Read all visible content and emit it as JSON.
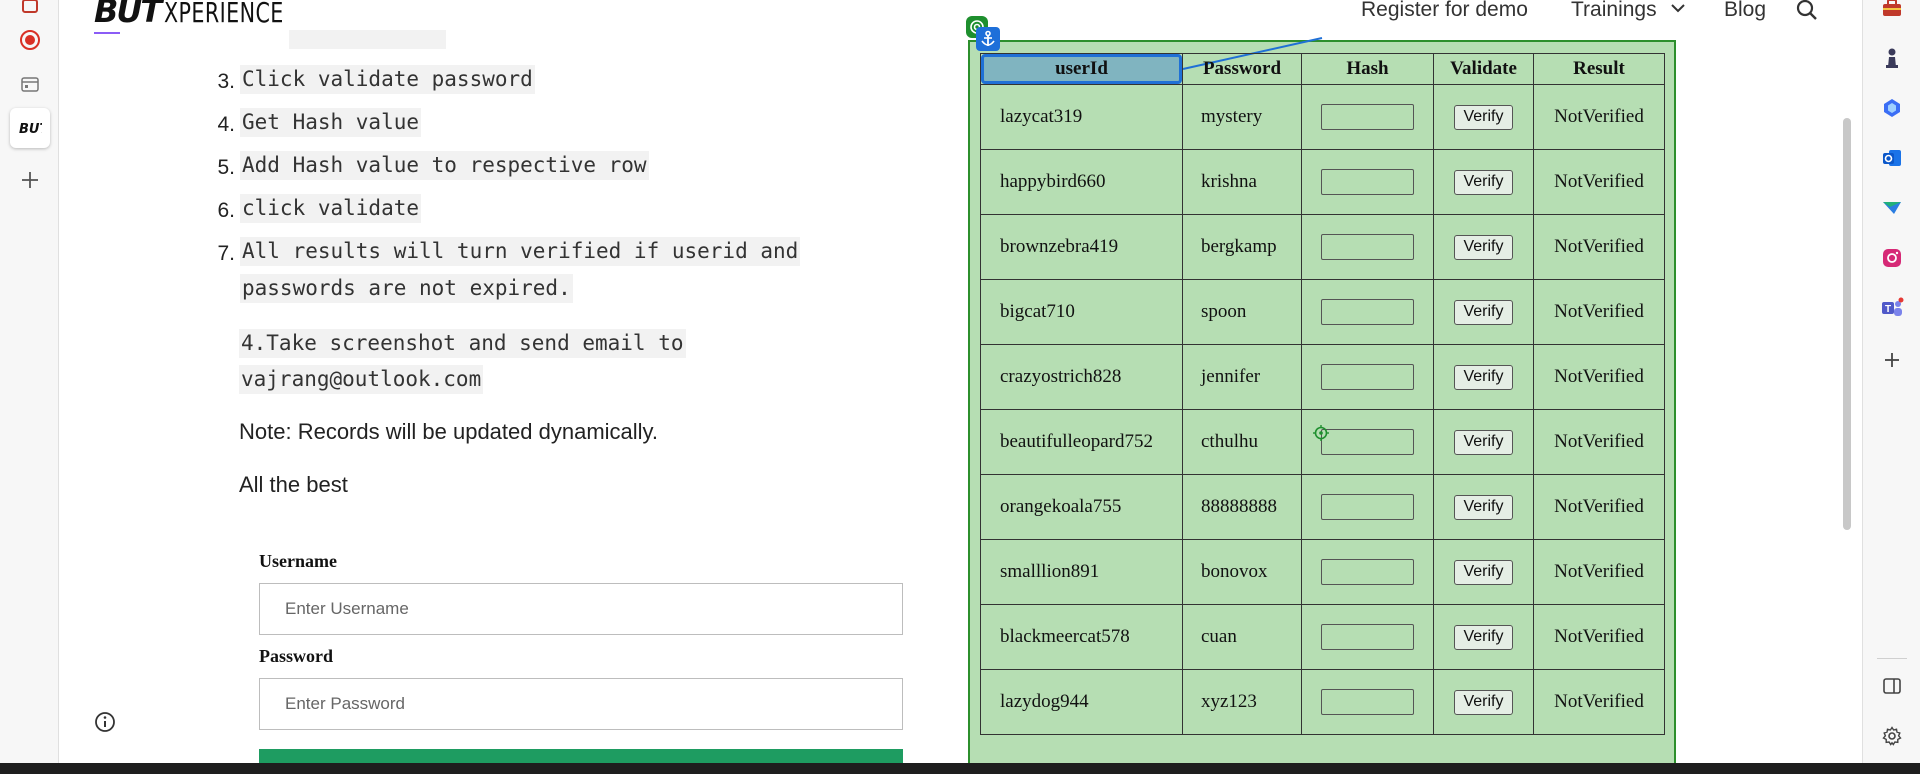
{
  "header": {
    "logo_mark": "BUT",
    "logo_text": "XPERIENCE",
    "nav": {
      "register": "Register for demo",
      "trainings": "Trainings",
      "blog": "Blog"
    }
  },
  "instructions": {
    "steps": [
      {
        "num": "3.",
        "text": "Click validate password"
      },
      {
        "num": "4.",
        "text": "Get Hash value"
      },
      {
        "num": "5.",
        "text": "Add Hash value to respective row"
      },
      {
        "num": "6.",
        "text": "click validate"
      },
      {
        "num": "7.",
        "text": "All results will turn verified if userid and",
        "text2": "passwords are not expired."
      }
    ],
    "email_line1": "4.Take screenshot and send email to",
    "email_line2": "vajrang@outlook.com",
    "note": "Note: Records will be updated dynamically.",
    "closing": "All the best"
  },
  "form": {
    "username_label": "Username",
    "username_placeholder": "Enter Username",
    "password_label": "Password",
    "password_placeholder": "Enter Password"
  },
  "table": {
    "headers": {
      "userid": "userId",
      "password": "Password",
      "hash": "Hash",
      "validate": "Validate",
      "result": "Result"
    },
    "verify_label": "Verify",
    "rows": [
      {
        "user": "lazycat319",
        "pass": "mystery",
        "result": "NotVerified"
      },
      {
        "user": "happybird660",
        "pass": "krishna",
        "result": "NotVerified"
      },
      {
        "user": "brownzebra419",
        "pass": "bergkamp",
        "result": "NotVerified"
      },
      {
        "user": "bigcat710",
        "pass": "spoon",
        "result": "NotVerified"
      },
      {
        "user": "crazyostrich828",
        "pass": "jennifer",
        "result": "NotVerified"
      },
      {
        "user": "beautifulleopard752",
        "pass": "cthulhu",
        "result": "NotVerified"
      },
      {
        "user": "orangekoala755",
        "pass": "88888888",
        "result": "NotVerified"
      },
      {
        "user": "smalllion891",
        "pass": "bonovox",
        "result": "NotVerified"
      },
      {
        "user": "blackmeercat578",
        "pass": "cuan",
        "result": "NotVerified"
      },
      {
        "user": "lazydog944",
        "pass": "xyz123",
        "result": "NotVerified"
      }
    ]
  },
  "colors": {
    "panel_bg": "#b6deb3",
    "panel_border": "#2c8f2c",
    "selection_blue": "#1f70d6",
    "selected_header_bg": "#80b4c0",
    "form_button": "#1e9c61"
  }
}
